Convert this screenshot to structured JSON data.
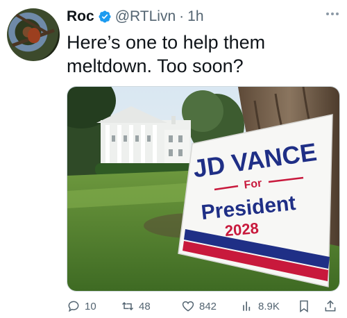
{
  "author": {
    "display_name": "Roc",
    "handle": "@RTLivn",
    "separator": "·",
    "time": "1h",
    "verified": true,
    "verified_color": "#1d9bf0"
  },
  "tweet": {
    "text": "Here’s one to help them\nmeltdown.  Too soon?"
  },
  "media": {
    "sign": {
      "line1": "JD VANCE",
      "line2": "For",
      "line3": "President",
      "line4": "2028",
      "blue": "#1f2f86",
      "red": "#c8193c"
    }
  },
  "actions": {
    "replies": "10",
    "retweets": "48",
    "likes": "842",
    "views": "8.9K"
  },
  "icons": {
    "more": "more-dots-icon",
    "reply": "reply-icon",
    "retweet": "retweet-icon",
    "like": "heart-icon",
    "views": "views-icon",
    "bookmark": "bookmark-icon",
    "share": "share-icon"
  }
}
